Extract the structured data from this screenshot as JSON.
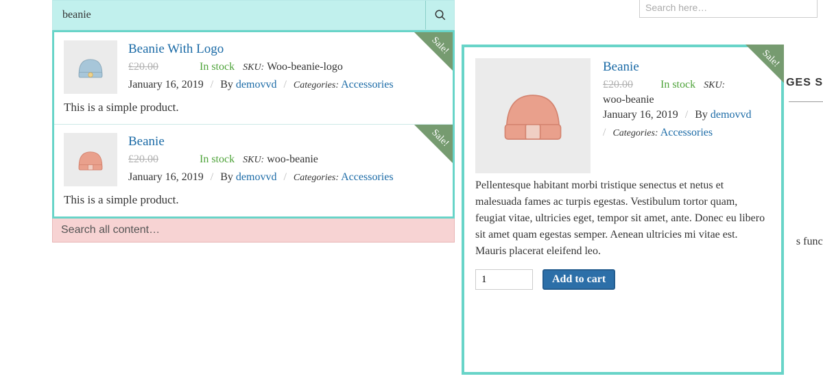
{
  "search": {
    "value": "beanie",
    "footer": "Search all content…"
  },
  "results": [
    {
      "title": "Beanie With Logo",
      "old_price": "£20.00",
      "stock": "In stock",
      "sku_label": "SKU:",
      "sku": "Woo-beanie-logo",
      "date": "January 16, 2019",
      "by_label": "By",
      "author": "demovvd",
      "cat_label": "Categories:",
      "category": "Accessories",
      "desc": "This is a simple product.",
      "sale": "Sale!",
      "icon_color": "#a7c6d9"
    },
    {
      "title": "Beanie",
      "old_price": "£20.00",
      "stock": "In stock",
      "sku_label": "SKU:",
      "sku": "woo-beanie",
      "date": "January 16, 2019",
      "by_label": "By",
      "author": "demovvd",
      "cat_label": "Categories:",
      "category": "Accessories",
      "desc": "This is a simple product.",
      "sale": "Sale!",
      "icon_color": "#e9a08c"
    }
  ],
  "detail": {
    "title": "Beanie",
    "old_price": "£20.00",
    "stock": "In stock",
    "sku_label": "SKU:",
    "sku": "woo-beanie",
    "date": "January 16, 2019",
    "by_label": "By",
    "author": "demovvd",
    "cat_label": "Categories:",
    "category": "Accessories",
    "desc": "Pellentesque habitant morbi tristique senectus et netus et malesuada fames ac turpis egestas. Vestibulum tortor quam, feugiat vitae, ultricies eget, tempor sit amet, ante. Donec eu libero sit amet quam egestas semper. Aenean ultricies mi vitae est. Mauris placerat eleifend leo.",
    "sale": "Sale!",
    "qty": "1",
    "add_to_cart": "Add to cart",
    "icon_color": "#e9a08c"
  },
  "bg": {
    "side_search": "Search here…",
    "ges": "GES S",
    "func": "s funct"
  }
}
